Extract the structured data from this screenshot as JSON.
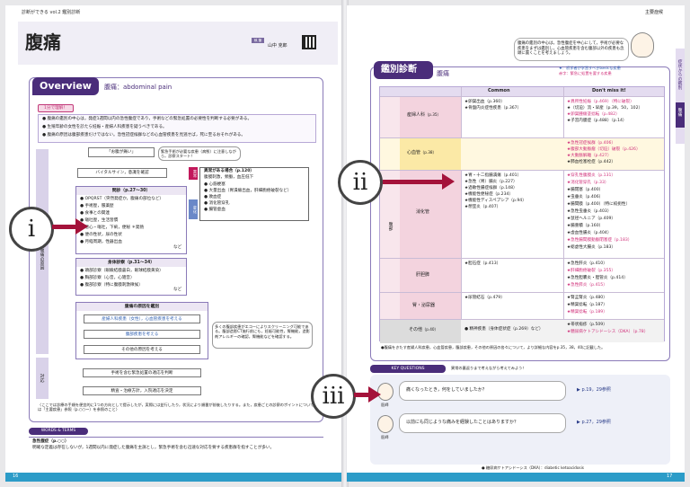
{
  "left_page": {
    "running_head": "診断ができる vol.2 鑑別診断",
    "title": "腹痛",
    "author_label": "執 筆",
    "author": "山中 克郎",
    "overview_label": "Overview",
    "overview_sub": "腹痛：abdominal pain",
    "one_minute": "1分で理解！",
    "bullets": [
      "腹痛の鑑別の中心は，発症1週間以内の急性腹症であり，手術などの緊急処置の必要性を判断する必要がある。",
      "生殖年齢の女性を診たら妊娠・産婦人科疾患を疑うべきである。",
      "腹痛の原因は腹部疾患だけではない。急性冠症候群などの心血管疾患を見逃せば，死に至るおそれがある。"
    ],
    "side_labels": [
      "腹痛の原因",
      "対応"
    ],
    "flow": {
      "start": "「お腹が痛い」",
      "start_note": "緊急手術が必要な疾患（病態）に注意しながら，診察スタート！",
      "vital": "バイタルサイン，意識を確認",
      "abnormal_tag": "異常",
      "abnormal_title": "異常がある場合",
      "abnormal_ref": "（p.120）",
      "abnormal_sub": "腹膜刺激，頻脈，血圧低下",
      "abnormal_items": [
        "心筋梗塞",
        "大量出血（胃潰瘍出血，肝細胞癌破裂など）",
        "敗血症",
        "消化管穿孔",
        "腸管虚血"
      ],
      "change_tag": "変化",
      "interview_title": "問診",
      "interview_ref": "（p.27〜30）",
      "interview_items": [
        "OPQRST（突然発症か，腹痛の部位など）",
        "手術歴，服薬歴",
        "食事との関連",
        "嘔吐歴，生活習慣",
        "悪心・嘔吐，下痢，便秘 ＊発熱",
        "便の性状，尿の性状",
        "月経周期，性器出血"
      ],
      "interview_more": "など",
      "exam_title": "身体診察",
      "exam_ref": "（p.31〜34）",
      "exam_items": [
        "頭部診察（眼瞼結膜蒼白，眼球結膜黄染）",
        "胸部診察（心音，心雑音）",
        "腹部診察（特に腹膜刺激徴候）"
      ],
      "exam_more": "など",
      "cause_title": "腹痛の原因を鑑別",
      "cause_items": [
        "産婦人科疾患（女性），心血管疾患を考える",
        "腹部疾患を考える",
        "その他の原因を考える"
      ],
      "cause_note": "多くの腹部疾患がエコーによりスクリーニング可能である。腹部造影CT施行前にも，妊娠可能性，腎機能，造影剤アレルギーの確認，腎機能などを確認する。",
      "step1": "手術を含む緊急処置の適応を判断",
      "step2": "精査・治療方針，入院適応を決定"
    },
    "footnote": "〈ここでは診療の手順を便宜的に1つの方向として提示したが，実際には並行したり，状況により順番が前後したりする。また，疾患ごとの診察のポイントについては「主要疾患」参照（p.○○〜）を参照のこと〉",
    "words_label": "WORDS & TERMS",
    "words_term": "急性腹症",
    "words_ref": "（p.○○）",
    "words_text": "明確な定義は存在しないが，1週間以内に発症した腹痛を主訴とし，緊急手術を含む迅速な対応を要する疾患群を指すことが多い。",
    "page_no": "16"
  },
  "right_page": {
    "running_head": "主要症候",
    "intro": "腹痛の鑑別の中心は，急性腹症を中心にして，手術が必要な疾患をまずは鑑別し，心血管疾患を含む腹部以外の疾患も念頭に置くことを考えましょう。",
    "diff_label": "鑑別診断",
    "diff_sub": "腹痛",
    "legend1": "★：初学者が学習すべきbasicな疾患",
    "legend2": "赤字：緊急に処置を要する疾患",
    "side_tab1": "症状からの鑑別",
    "side_tab2": "腹痛",
    "columns": [
      "Common",
      "Don't miss it!"
    ],
    "rows": [
      {
        "name": "産婦人科",
        "ref": "（p.35）",
        "common": [
          "★卵巣出血（p.360）",
          "★骨盤内炎症性疾患（p.367）"
        ],
        "dont": [
          "★異所性妊娠（p.469）（特に破裂）",
          "★（切迫）流・早産（p.39，50，102）",
          "★卵巣腫瘍茎捻転（p.482）",
          "★子宮内膜症（p.488）（p.14）"
        ]
      },
      {
        "name": "心血管",
        "ref": "（p.38）",
        "common": [],
        "dont": [
          "★急性冠症候群（p.406）",
          "★腹部大動脈瘤（切迫）破裂（p.426）",
          "★大動脈解離（p.427）",
          "★肺血栓塞栓症（p.442）"
        ]
      },
      {
        "name": "消化管",
        "ref": "",
        "common": [
          "★胃・十二指腸潰瘍（p.401）",
          "★急性（胃）腸炎（p.227）",
          "★過敏性腸症候群（p.148）",
          "★機能性便秘症（p.234）",
          "★機能性ディスペプシア（p.94）",
          "★憩室炎（p.407）"
        ],
        "dont": [
          "★穿孔性腹膜炎（p.131）",
          "★消化管穿孔（p.33）",
          "★腸閉塞（p.400）",
          "★虫垂炎（p.406）",
          "★腸間膜（p.400）（特に絞扼性）",
          "★急性虫垂炎（p.403）",
          "★鼠径ヘルニア（p.409）",
          "★腸重積（p.160）",
          "★虚血性腸炎（p.404）",
          "★急性腸間膜動脈閉塞症（p.183）",
          "★総虚性大腸炎（p.183）"
        ]
      },
      {
        "name": "肝胆膵",
        "ref": "",
        "common": [
          "★胆石症（p.413）"
        ],
        "dont": [
          "★急性肝炎（p.410）",
          "★肝細胞癌破裂（p.355）",
          "★急性胆嚢炎・胆管炎（p.414）",
          "★急性膵炎（p.415）"
        ]
      },
      {
        "name": "腎・泌尿器",
        "ref": "",
        "common": [
          "★尿管結石（p.479）"
        ],
        "dont": [
          "★腎盂腎炎（p.480）",
          "★精巣捻転（p.187）",
          "★精巣捻転（p.189）"
        ]
      },
      {
        "name": "その他",
        "ref": "（p.40）",
        "common": [
          "● 精神疾患（身体症状症（p.269）など）"
        ],
        "dont": [
          "★帯状疱疹（p.509）",
          "★糖尿病ケトアシドーシス（DKA）（p.78）"
        ]
      }
    ],
    "side_row_label": "腹部",
    "table_note": "●腹痛をきたす産婦人科疾患，心血管疾患，腹部疾患，その他の原因の各々について，より詳細な内容をp.35，38，40に記載した。",
    "kq_label": "KEY QUESTIONS",
    "kq_sub": "異常の裏返りまで考えながら考えてみよう！",
    "kq_items": [
      {
        "role": "医師",
        "q": "痛くなったとき，何をしていましたか？",
        "ref": "p.19，29参照"
      },
      {
        "role": "医師",
        "q": "以前にも同じような痛みを経験したことはありますか？",
        "ref": "p.27，29参照"
      }
    ],
    "footer_note": "● 糖尿病ケトアシドーシス（DKA）：diabetic ketoacidosis",
    "page_no": "17"
  },
  "callouts": [
    "i",
    "ii",
    "iii"
  ]
}
